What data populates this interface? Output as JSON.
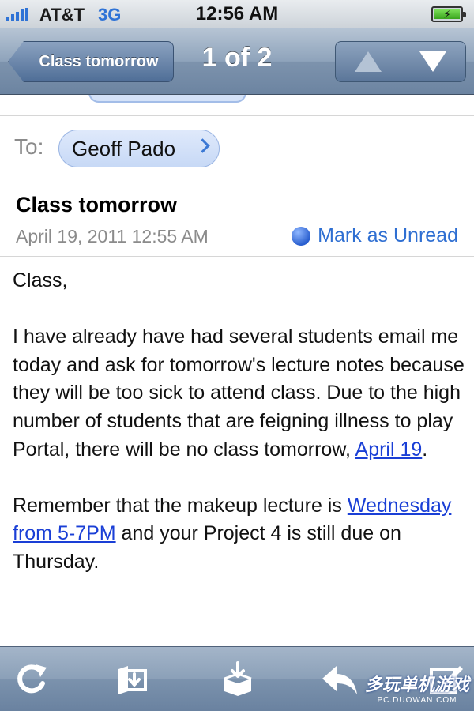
{
  "status_bar": {
    "carrier": "AT&T",
    "network": "3G",
    "time": "12:56 AM",
    "battery_symbol": "⚡"
  },
  "nav": {
    "back_label": "Class tomorrow",
    "title": "1 of 2"
  },
  "header": {
    "to_label": "To:",
    "recipient": "Geoff Pado",
    "subject": "Class tomorrow",
    "date": "April 19, 2011 12:55 AM",
    "mark_unread": "Mark as Unread"
  },
  "body": {
    "greeting": "Class,",
    "p1_text": "I have already have had several students email me today and ask for tomorrow's lecture notes because they will be too sick to attend class. Due to the high number of students that are feigning illness to play Portal, there will be no class tomorrow, ",
    "p1_link": "April 19",
    "p1_end": ".",
    "p2_link": "Wednesday from 5-7PM",
    "p2_start": "Remember that the makeup lecture is ",
    "p2_end": " and your Project 4 is still due on Thursday."
  },
  "toolbar": {
    "icons": [
      "refresh-icon",
      "move-folder-icon",
      "archive-icon",
      "reply-icon",
      "compose-icon"
    ]
  },
  "watermark": {
    "big": "多玩单机游戏",
    "small": "PC.DUOWAN.COM"
  },
  "colors": {
    "link": "#1a3fd6",
    "accent": "#2f6fd2",
    "nav_blue": "#6c84a1"
  }
}
